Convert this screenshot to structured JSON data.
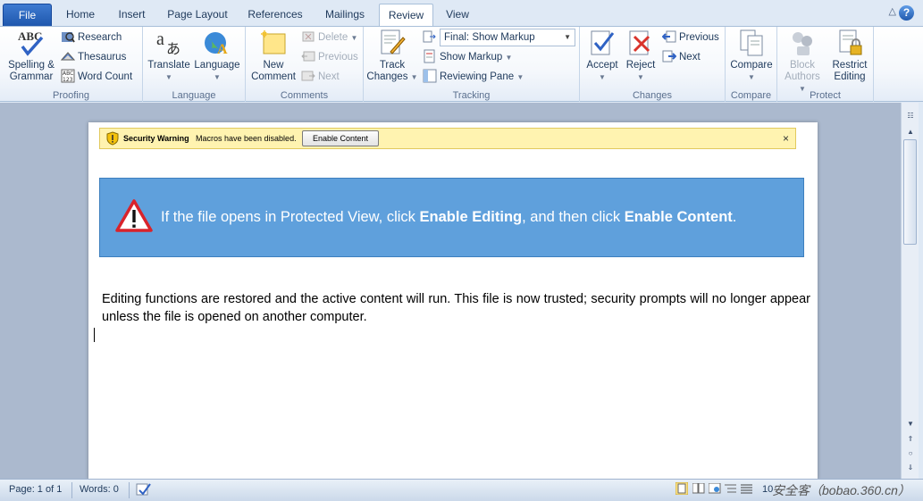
{
  "tabs": [
    {
      "label": "File"
    },
    {
      "label": "Home"
    },
    {
      "label": "Insert"
    },
    {
      "label": "Page Layout"
    },
    {
      "label": "References"
    },
    {
      "label": "Mailings"
    },
    {
      "label": "Review"
    },
    {
      "label": "View"
    }
  ],
  "active_tab": "Review",
  "ribbon": {
    "proofing": {
      "label": "Proofing",
      "spelling_line1": "Spelling &",
      "spelling_line2": "Grammar",
      "research": "Research",
      "thesaurus": "Thesaurus",
      "word_count": "Word Count"
    },
    "language": {
      "label": "Language",
      "translate": "Translate",
      "language": "Language"
    },
    "comments": {
      "label": "Comments",
      "new_line1": "New",
      "new_line2": "Comment",
      "delete": "Delete",
      "previous": "Previous",
      "next": "Next"
    },
    "tracking": {
      "label": "Tracking",
      "track_line1": "Track",
      "track_line2": "Changes",
      "markup_select": "Final: Show Markup",
      "show_markup": "Show Markup",
      "reviewing_pane": "Reviewing Pane"
    },
    "changes": {
      "label": "Changes",
      "accept": "Accept",
      "reject": "Reject",
      "previous": "Previous",
      "next": "Next"
    },
    "compare": {
      "label": "Compare",
      "compare": "Compare"
    },
    "protect": {
      "label": "Protect",
      "block_line1": "Block",
      "block_line2": "Authors",
      "restrict_line1": "Restrict",
      "restrict_line2": "Editing"
    }
  },
  "security_bar": {
    "title": "Security Warning",
    "message": "Macros have been disabled.",
    "button": "Enable Content",
    "close": "×"
  },
  "callout": {
    "part1": "If the file opens in Protected View, click ",
    "bold1": "Enable Editing",
    "part2": ", and then click ",
    "bold2": "Enable Content",
    "part3": "."
  },
  "document": {
    "paragraph": "Editing functions are restored and the active content will run. This file is now trusted; security prompts will no longer appear unless the file is opened on another computer."
  },
  "statusbar": {
    "page": "Page: 1 of 1",
    "words": "Words: 0",
    "zoom": "10",
    "watermark": "安全客（bobao.360.cn）"
  },
  "colors": {
    "callout_bg": "#5fa0dc",
    "security_bar_bg": "#fff3b0",
    "file_tab": "#2a63b8"
  }
}
